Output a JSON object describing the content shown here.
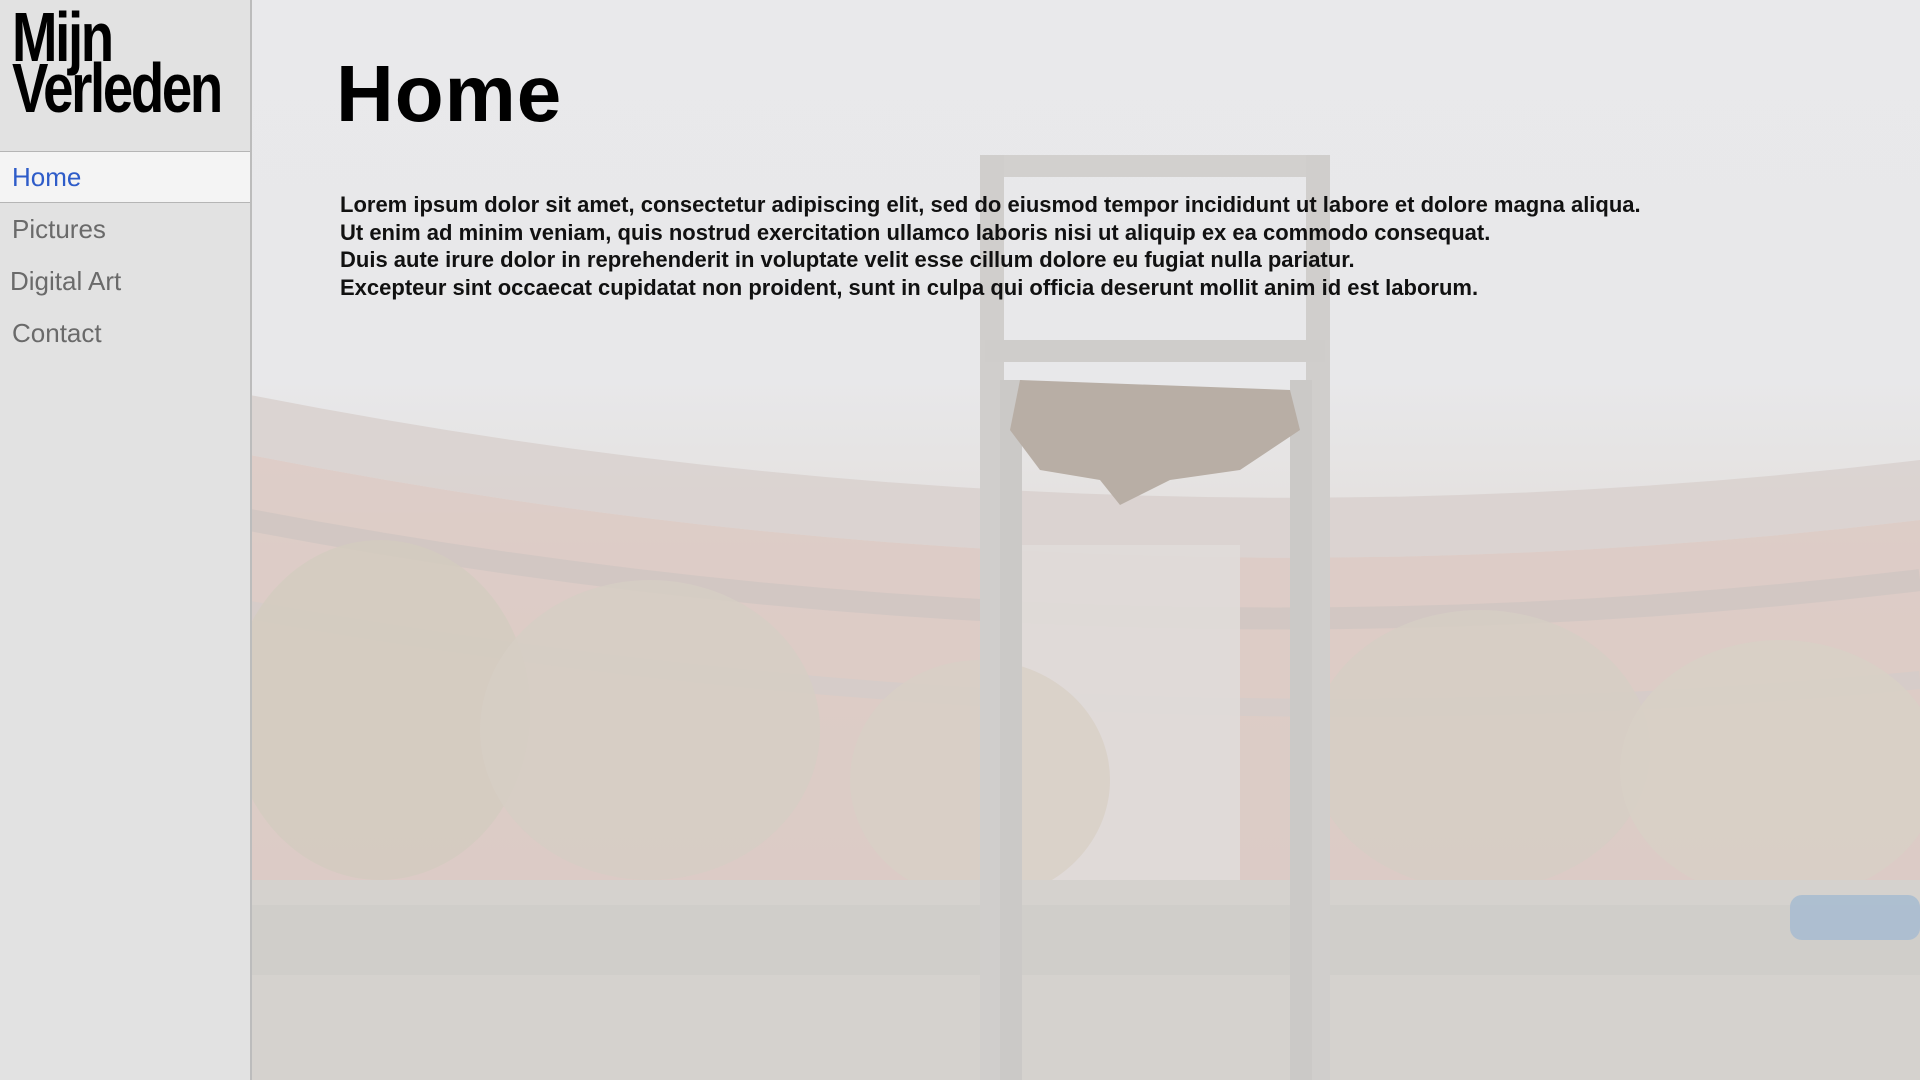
{
  "site": {
    "logo_line1": "Mijn",
    "logo_line2": "Verleden"
  },
  "nav": {
    "items": [
      {
        "label": "Home",
        "active": true
      },
      {
        "label": "Pictures",
        "active": false
      },
      {
        "label": "Digital Art",
        "active": false
      },
      {
        "label": "Contact",
        "active": false
      }
    ]
  },
  "page": {
    "title": "Home",
    "paragraphs": [
      "Lorem ipsum dolor sit amet, consectetur adipiscing elit, sed do eiusmod tempor incididunt ut labore et dolore magna aliqua.",
      "Ut enim ad minim veniam, quis nostrud exercitation ullamco laboris nisi ut aliquip ex ea commodo consequat.",
      "Duis aute irure dolor in reprehenderit in voluptate velit esse cillum dolore eu fugiat nulla pariatur.",
      "Excepteur sint occaecat cupidatat non proident, sunt in culpa qui officia deserunt mollit anim id est laborum."
    ]
  },
  "colors": {
    "nav_active": "#2e5cc9",
    "nav_inactive": "#6a6a6a",
    "sidebar_bg": "#e2e2e2",
    "text": "#000000"
  }
}
